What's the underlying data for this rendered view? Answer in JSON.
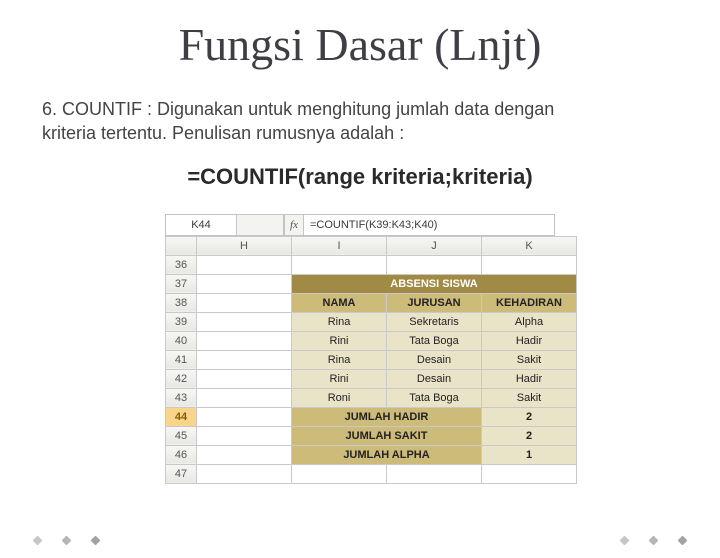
{
  "title": "Fungsi Dasar (Lnjt)",
  "description": "6. COUNTIF :  Digunakan untuk menghitung jumlah data dengan kriteria tertentu. Penulisan rumusnya adalah :",
  "formula": "=COUNTIF(range kriteria;kriteria)",
  "sheet": {
    "namebox": "K44",
    "fx": "=COUNTIF(K39:K43;K40)",
    "cols": [
      "H",
      "I",
      "J",
      "K"
    ],
    "row_start": 36,
    "row_end": 47,
    "selected_row": 44,
    "tableTitle": "ABSENSI SISWA",
    "headers": [
      "NAMA",
      "JURUSAN",
      "KEHADIRAN"
    ],
    "rows": [
      {
        "r": 39,
        "nama": "Rina",
        "jurusan": "Sekretaris",
        "hadir": "Alpha"
      },
      {
        "r": 40,
        "nama": "Rini",
        "jurusan": "Tata Boga",
        "hadir": "Hadir"
      },
      {
        "r": 41,
        "nama": "Rina",
        "jurusan": "Desain",
        "hadir": "Sakit"
      },
      {
        "r": 42,
        "nama": "Rini",
        "jurusan": "Desain",
        "hadir": "Hadir"
      },
      {
        "r": 43,
        "nama": "Roni",
        "jurusan": "Tata Boga",
        "hadir": "Sakit"
      }
    ],
    "summary": [
      {
        "r": 44,
        "label": "JUMLAH HADIR",
        "val": "2"
      },
      {
        "r": 45,
        "label": "JUMLAH SAKIT",
        "val": "2"
      },
      {
        "r": 46,
        "label": "JUMLAH ALPHA",
        "val": "1"
      }
    ]
  }
}
